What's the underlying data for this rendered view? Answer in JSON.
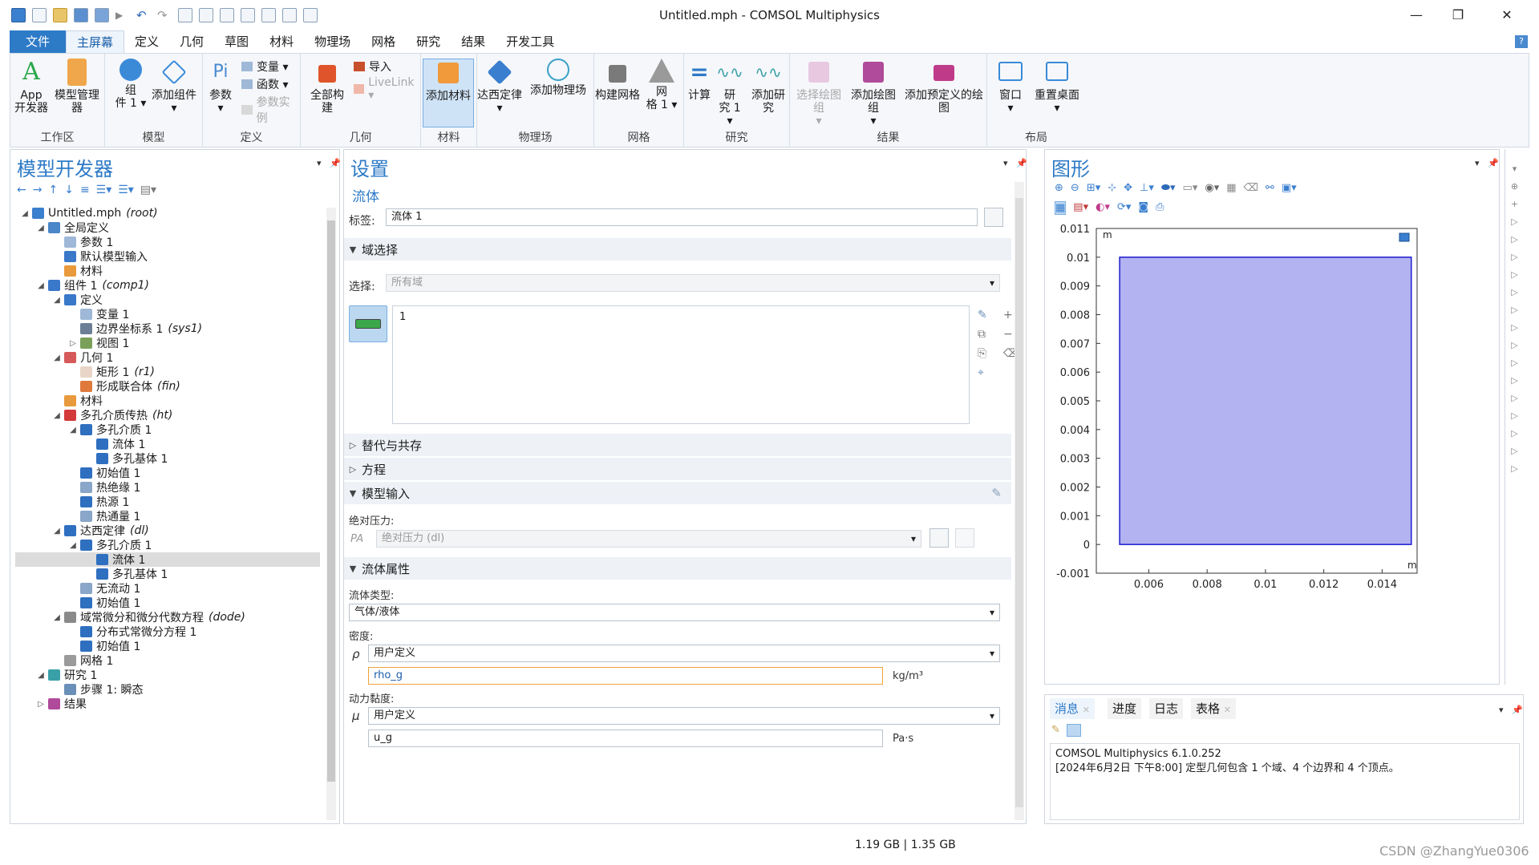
{
  "window": {
    "title": "Untitled.mph - COMSOL Multiphysics",
    "minimize": "—",
    "maximize": "❐",
    "close": "✕"
  },
  "tabs": [
    "文件",
    "主屏幕",
    "定义",
    "几何",
    "草图",
    "材料",
    "物理场",
    "网格",
    "研究",
    "结果",
    "开发工具"
  ],
  "ribbon": {
    "groups": {
      "workspace": "工作区",
      "model": "模型",
      "definitions": "定义",
      "geometry": "几何",
      "materials": "材料",
      "physics": "物理场",
      "mesh": "网格",
      "study": "研究",
      "results": "结果",
      "layout": "布局"
    },
    "app_builder": "App\n开发器",
    "model_manager": "模型管理器",
    "component": "组\n件 1 ▾",
    "add_component": "添加组件\n▾",
    "parameters": "参数\n▾",
    "variables": "变量 ▾",
    "functions": "函数 ▾",
    "parameter_case": "参数实例",
    "build_all": "全部构建",
    "import": "导入",
    "livelink": "LiveLink ▾",
    "add_material": "添加材料",
    "darcy": "达西定律\n▾",
    "add_physics": "添加物理场",
    "build_mesh": "构建网格",
    "mesh1": "网\n格 1 ▾",
    "compute": "计算",
    "study1": "研\n究 1 ▾",
    "add_study": "添加研究",
    "select_plot_group": "选择绘图组\n▾",
    "add_plot_group": "添加绘图组\n▾",
    "add_predefined_plot": "添加预定义的绘图",
    "windows": "窗口\n▾",
    "reset_desktop": "重置桌面\n▾"
  },
  "model_builder": {
    "title": "模型开发器",
    "tree": [
      {
        "label": "Untitled.mph",
        "tag": "(root)",
        "indent": 0,
        "toggle": "◢",
        "icon": "#3b7fcf"
      },
      {
        "label": "全局定义",
        "tag": "",
        "indent": 1,
        "toggle": "◢",
        "icon": "#4a86c8"
      },
      {
        "label": "参数 1",
        "tag": "",
        "indent": 2,
        "toggle": "",
        "icon": "#9fb8d8"
      },
      {
        "label": "默认模型输入",
        "tag": "",
        "indent": 2,
        "toggle": "",
        "icon": "#3a78c9"
      },
      {
        "label": "材料",
        "tag": "",
        "indent": 2,
        "toggle": "",
        "icon": "#e89a3c"
      },
      {
        "label": "组件 1",
        "tag": "(comp1)",
        "indent": 1,
        "toggle": "◢",
        "icon": "#3a78c9"
      },
      {
        "label": "定义",
        "tag": "",
        "indent": 2,
        "toggle": "◢",
        "icon": "#3a78c9"
      },
      {
        "label": "变量 1",
        "tag": "",
        "indent": 3,
        "toggle": "",
        "icon": "#9fb8d8"
      },
      {
        "label": "边界坐标系 1",
        "tag": "(sys1)",
        "indent": 3,
        "toggle": "",
        "icon": "#6c7f96"
      },
      {
        "label": "视图 1",
        "tag": "",
        "indent": 3,
        "toggle": "▷",
        "icon": "#7aa05a"
      },
      {
        "label": "几何 1",
        "tag": "",
        "indent": 2,
        "toggle": "◢",
        "icon": "#d65a5a"
      },
      {
        "label": "矩形 1",
        "tag": "(r1)",
        "indent": 3,
        "toggle": "",
        "icon": "#e8d5c8"
      },
      {
        "label": "形成联合体",
        "tag": "(fin)",
        "indent": 3,
        "toggle": "",
        "icon": "#e07a3c"
      },
      {
        "label": "材料",
        "tag": "",
        "indent": 2,
        "toggle": "",
        "icon": "#e89a3c"
      },
      {
        "label": "多孔介质传热",
        "tag": "(ht)",
        "indent": 2,
        "toggle": "◢",
        "icon": "#d33a3a"
      },
      {
        "label": "多孔介质 1",
        "tag": "",
        "indent": 3,
        "toggle": "◢",
        "icon": "#2f6fc0"
      },
      {
        "label": "流体 1",
        "tag": "",
        "indent": 4,
        "toggle": "",
        "icon": "#2f6fc0"
      },
      {
        "label": "多孔基体 1",
        "tag": "",
        "indent": 4,
        "toggle": "",
        "icon": "#2f6fc0"
      },
      {
        "label": "初始值 1",
        "tag": "",
        "indent": 3,
        "toggle": "",
        "icon": "#2f6fc0"
      },
      {
        "label": "热绝缘 1",
        "tag": "",
        "indent": 3,
        "toggle": "",
        "icon": "#8aa6c8"
      },
      {
        "label": "热源 1",
        "tag": "",
        "indent": 3,
        "toggle": "",
        "icon": "#2f6fc0"
      },
      {
        "label": "热通量 1",
        "tag": "",
        "indent": 3,
        "toggle": "",
        "icon": "#8aa6c8"
      },
      {
        "label": "达西定律",
        "tag": "(dl)",
        "indent": 2,
        "toggle": "◢",
        "icon": "#2f6fc0"
      },
      {
        "label": "多孔介质 1",
        "tag": "",
        "indent": 3,
        "toggle": "◢",
        "icon": "#2f6fc0"
      },
      {
        "label": "流体 1",
        "tag": "",
        "indent": 4,
        "toggle": "",
        "icon": "#2f6fc0",
        "selected": true
      },
      {
        "label": "多孔基体 1",
        "tag": "",
        "indent": 4,
        "toggle": "",
        "icon": "#2f6fc0"
      },
      {
        "label": "无流动 1",
        "tag": "",
        "indent": 3,
        "toggle": "",
        "icon": "#8aa6c8"
      },
      {
        "label": "初始值 1",
        "tag": "",
        "indent": 3,
        "toggle": "",
        "icon": "#2f6fc0"
      },
      {
        "label": "域常微分和微分代数方程",
        "tag": "(dode)",
        "indent": 2,
        "toggle": "◢",
        "icon": "#8a8a8a"
      },
      {
        "label": "分布式常微分方程 1",
        "tag": "",
        "indent": 3,
        "toggle": "",
        "icon": "#2f6fc0"
      },
      {
        "label": "初始值 1",
        "tag": "",
        "indent": 3,
        "toggle": "",
        "icon": "#2f6fc0"
      },
      {
        "label": "网格 1",
        "tag": "",
        "indent": 2,
        "toggle": "",
        "icon": "#9a9a9a"
      },
      {
        "label": "研究 1",
        "tag": "",
        "indent": 1,
        "toggle": "◢",
        "icon": "#3aa0a8"
      },
      {
        "label": "步骤 1: 瞬态",
        "tag": "",
        "indent": 2,
        "toggle": "",
        "icon": "#6a8fb8"
      },
      {
        "label": "结果",
        "tag": "",
        "indent": 1,
        "toggle": "▷",
        "icon": "#b04a9a"
      }
    ]
  },
  "settings": {
    "title": "设置",
    "subtitle": "流体",
    "label_caption": "标签:",
    "label_value": "流体 1",
    "sections": {
      "domain_selection": "域选择",
      "override": "替代与共存",
      "equation": "方程",
      "model_input": "模型输入",
      "fluid_properties": "流体属性"
    },
    "selection_caption": "选择:",
    "selection_value": "所有域",
    "selection_list": [
      "1"
    ],
    "abs_pressure_caption": "绝对压力:",
    "abs_pressure_symbol": "PA",
    "abs_pressure_value": "绝对压力 (dl)",
    "fluid_type_caption": "流体类型:",
    "fluid_type_value": "气体/液体",
    "density_caption": "密度:",
    "density_symbol": "ρ",
    "density_option": "用户定义",
    "density_expr": "rho_g",
    "density_unit": "kg/m³",
    "viscosity_caption": "动力黏度:",
    "viscosity_symbol": "μ",
    "viscosity_option": "用户定义",
    "viscosity_expr": "u_g",
    "viscosity_unit": "Pa·s"
  },
  "graphics": {
    "title": "图形",
    "y_unit": "m",
    "x_unit": "m",
    "y_ticks": [
      "0.011",
      "0.01",
      "0.009",
      "0.008",
      "0.007",
      "0.006",
      "0.005",
      "0.004",
      "0.003",
      "0.002",
      "0.001",
      "0",
      "-0.001"
    ],
    "x_ticks": [
      "0.006",
      "0.008",
      "0.01",
      "0.012",
      "0.014"
    ],
    "domain_fill": "#b3b3f1",
    "domain_stroke": "#1c1ccf"
  },
  "messages": {
    "tabs": [
      "消息",
      "进度",
      "日志",
      "表格"
    ],
    "lines": [
      "COMSOL Multiphysics 6.1.0.252",
      "[2024年6月2日 下午8:00] 定型几何包含 1 个域、4 个边界和 4 个顶点。"
    ]
  },
  "status": {
    "memory": "1.19 GB | 1.35 GB",
    "watermark": "CSDN @ZhangYue0306"
  }
}
